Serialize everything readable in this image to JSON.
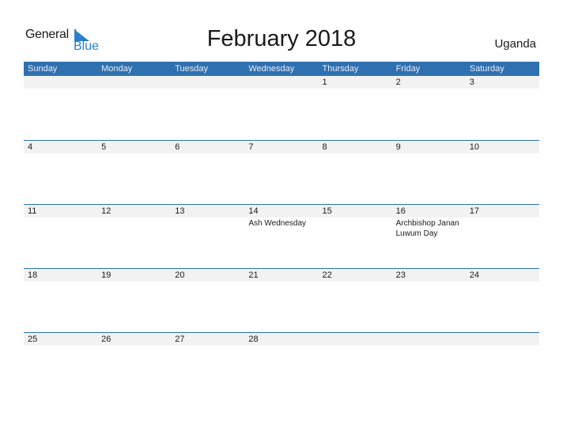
{
  "brand": {
    "general": "General",
    "blue": "Blue",
    "accent": "#2b80c9"
  },
  "title": "February 2018",
  "country": "Uganda",
  "colors": {
    "header_bg": "#2f70b0",
    "row_band": "#f2f2f2"
  },
  "weekdays": [
    "Sunday",
    "Monday",
    "Tuesday",
    "Wednesday",
    "Thursday",
    "Friday",
    "Saturday"
  ],
  "weeks": [
    [
      {
        "day": ""
      },
      {
        "day": ""
      },
      {
        "day": ""
      },
      {
        "day": ""
      },
      {
        "day": "1"
      },
      {
        "day": "2"
      },
      {
        "day": "3"
      }
    ],
    [
      {
        "day": "4"
      },
      {
        "day": "5"
      },
      {
        "day": "6"
      },
      {
        "day": "7"
      },
      {
        "day": "8"
      },
      {
        "day": "9"
      },
      {
        "day": "10"
      }
    ],
    [
      {
        "day": "11"
      },
      {
        "day": "12"
      },
      {
        "day": "13"
      },
      {
        "day": "14",
        "event": "Ash Wednesday"
      },
      {
        "day": "15"
      },
      {
        "day": "16",
        "event": "Archbishop Janan Luwum Day"
      },
      {
        "day": "17"
      }
    ],
    [
      {
        "day": "18"
      },
      {
        "day": "19"
      },
      {
        "day": "20"
      },
      {
        "day": "21"
      },
      {
        "day": "22"
      },
      {
        "day": "23"
      },
      {
        "day": "24"
      }
    ],
    [
      {
        "day": "25"
      },
      {
        "day": "26"
      },
      {
        "day": "27"
      },
      {
        "day": "28"
      },
      {
        "day": ""
      },
      {
        "day": ""
      },
      {
        "day": ""
      }
    ]
  ]
}
